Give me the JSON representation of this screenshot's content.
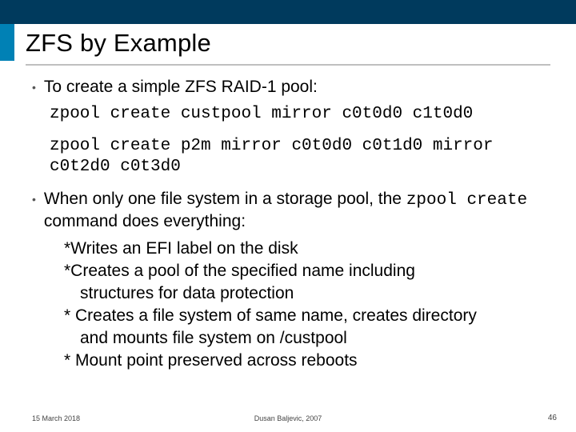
{
  "title": "ZFS by Example",
  "bullets": {
    "b1": "To create a simple ZFS RAID-1 pool:",
    "code1": "zpool create custpool mirror c0t0d0 c1t0d0",
    "code2": "zpool create p2m mirror c0t0d0 c0t1d0 mirror c0t2d0 c0t3d0",
    "b2_pre": "When only one file system in a storage pool, the ",
    "b2_code": "zpool create",
    "b2_post": " command does everything:",
    "sub1": "*Writes an EFI label on the disk",
    "sub2": "*Creates a pool of the specified name including",
    "sub2b": "structures for data protection",
    "sub3": "* Creates a file system of same name, creates directory",
    "sub3b": "and mounts file system on /custpool",
    "sub4": "* Mount point preserved across reboots"
  },
  "footer": {
    "left": "15 March 2018",
    "center": "Dusan Baljevic, 2007",
    "right": "46"
  }
}
